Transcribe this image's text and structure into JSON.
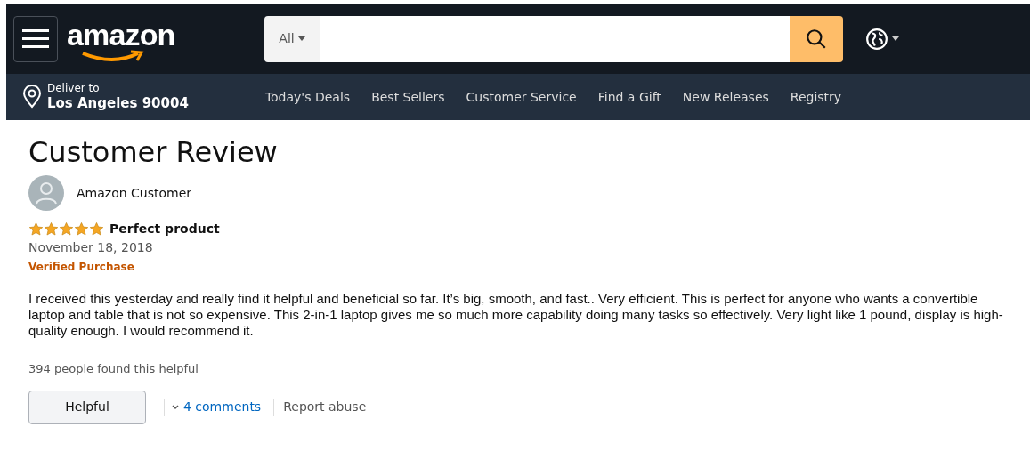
{
  "header": {
    "logo": "amazon",
    "search": {
      "category": "All"
    }
  },
  "nav": {
    "deliver_label": "Deliver to",
    "deliver_location": "Los Angeles 90004",
    "links": [
      "Today's Deals",
      "Best Sellers",
      "Customer Service",
      "Find a Gift",
      "New Releases",
      "Registry"
    ]
  },
  "review": {
    "heading": "Customer Review",
    "author": "Amazon Customer",
    "stars": 5,
    "title": "Perfect product",
    "date": "November 18, 2018",
    "badge": "Verified Purchase",
    "body": "I received this yesterday and really find it helpful and beneficial so far. It’s big, smooth, and fast.. Very efficient. This is perfect for anyone who wants a convertible laptop and table that is not so expensive. This 2-in-1 laptop gives me so much more capability doing many tasks so effectively. Very light like 1 pound, display is high-quality enough. I would recommend it.",
    "helpful_count": "394 people found this helpful",
    "helpful_button": "Helpful",
    "comments_link": "4 comments",
    "report_link": "Report abuse"
  }
}
